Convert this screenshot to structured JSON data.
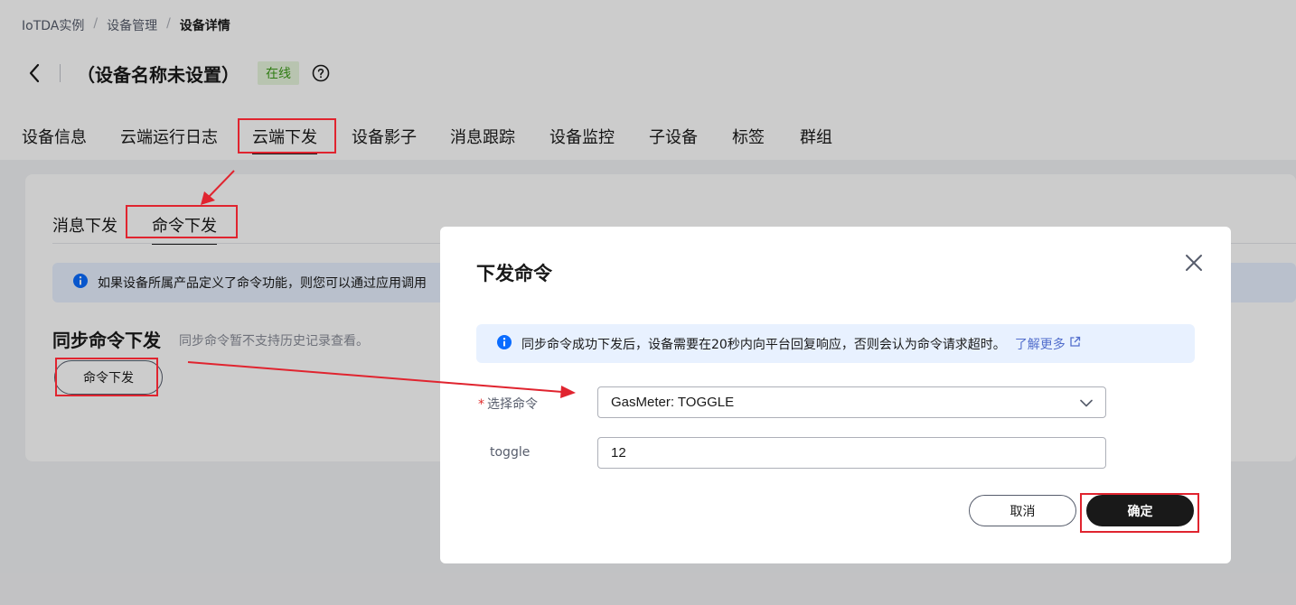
{
  "breadcrumb": {
    "items": [
      "IoTDA实例",
      "设备管理"
    ],
    "separator": "/",
    "current": "设备详情"
  },
  "header": {
    "title": "（设备名称未设置）",
    "status": "在线",
    "status_color": "#3c9b19"
  },
  "tabs": [
    {
      "label": "设备信息"
    },
    {
      "label": "云端运行日志"
    },
    {
      "label": "云端下发",
      "active": true
    },
    {
      "label": "设备影子"
    },
    {
      "label": "消息跟踪"
    },
    {
      "label": "设备监控"
    },
    {
      "label": "子设备"
    },
    {
      "label": "标签"
    },
    {
      "label": "群组"
    }
  ],
  "card": {
    "subtabs": [
      {
        "label": "消息下发"
      },
      {
        "label": "命令下发",
        "active": true
      }
    ],
    "banner_text": "如果设备所属产品定义了命令功能，则您可以通过应用调用",
    "section_title": "同步命令下发",
    "section_desc": "同步命令暂不支持历史记录查看。",
    "button_label": "命令下发"
  },
  "modal": {
    "title": "下发命令",
    "banner_text": "同步命令成功下发后，设备需要在20秒内向平台回复响应，否则会认为命令请求超时。",
    "banner_link": "了解更多",
    "select_label": "选择命令",
    "select_required_mark": "*",
    "select_value": "GasMeter: TOGGLE",
    "param_label": "toggle",
    "param_value": "12",
    "cancel_label": "取消",
    "ok_label": "确定"
  },
  "colors": {
    "annotation_red": "#e0242f",
    "info_blue": "#0a6cff",
    "link_blue": "#526ecc",
    "primary_button": "#191919"
  },
  "icons": [
    "back-arrow-icon",
    "help-icon",
    "info-icon",
    "close-icon",
    "external-link-icon",
    "chevron-down-icon"
  ]
}
